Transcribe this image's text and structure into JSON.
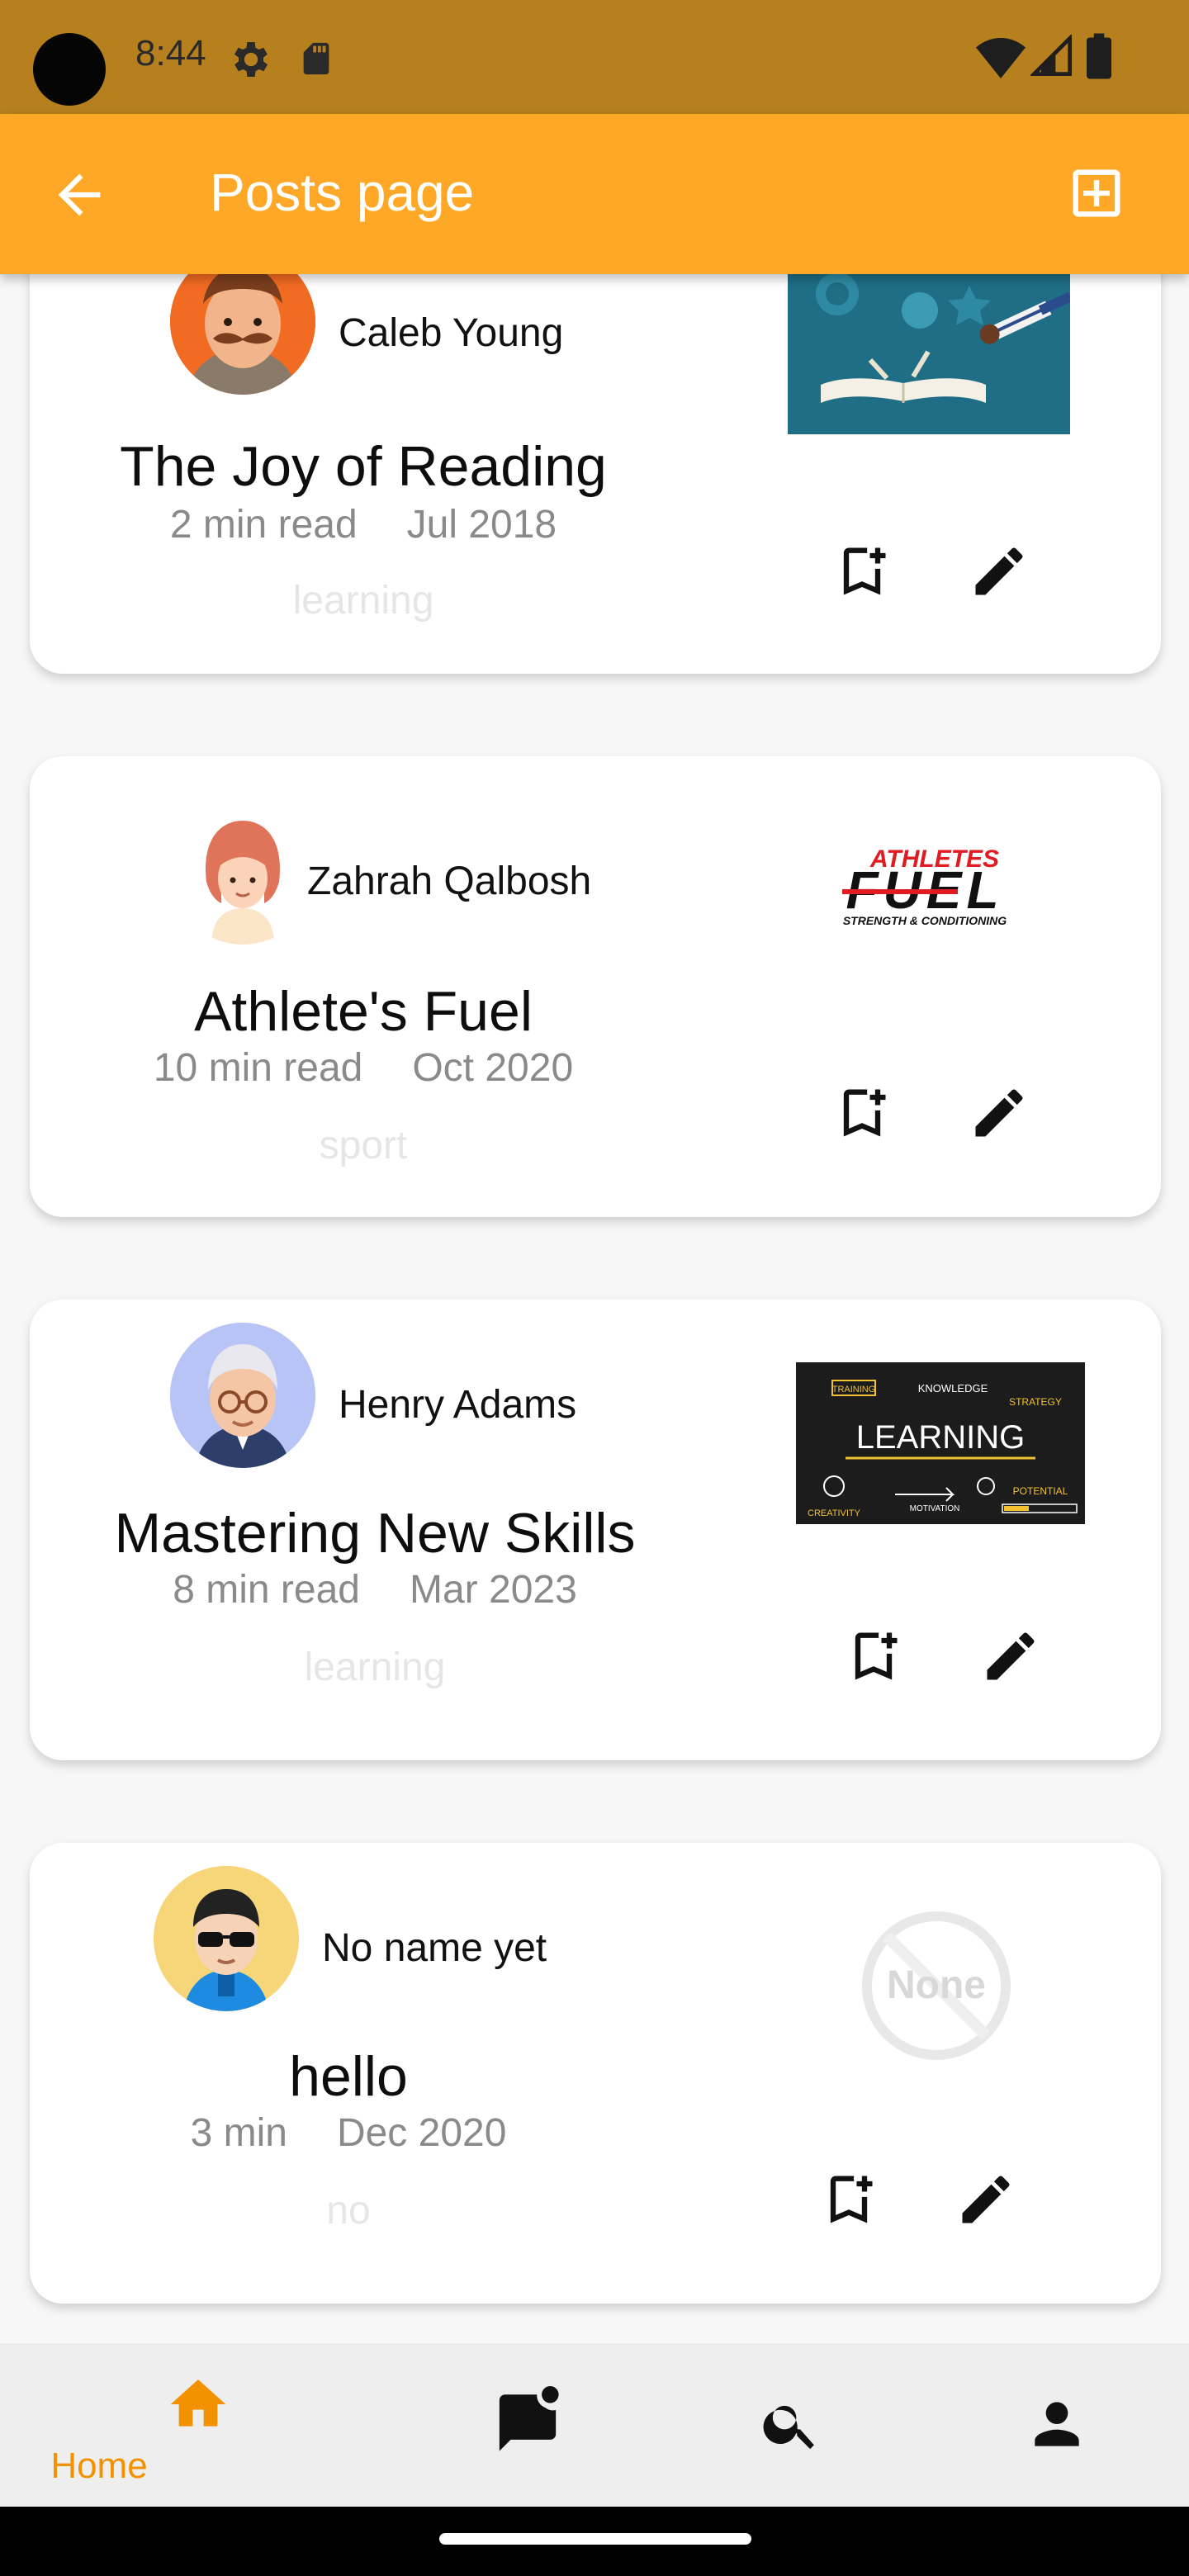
{
  "status_bar": {
    "time": "8:44",
    "background": "#B5801D"
  },
  "app_bar": {
    "title": "Posts page",
    "background": "#FFA726",
    "back_icon": "arrow-back-icon",
    "add_icon": "add-box-icon"
  },
  "posts": [
    {
      "author": "Caleb Young",
      "title": "The Joy of Reading",
      "read_time": "2 min read",
      "date": "Jul 2018",
      "tag": "learning",
      "avatar_icon": "mustache-man-avatar",
      "thumbnail_icon": "reading-illustration"
    },
    {
      "author": "Zahrah Qalbosh",
      "title": "Athlete's Fuel",
      "read_time": "10 min read",
      "date": "Oct 2020",
      "tag": "sport",
      "avatar_icon": "woman-avatar",
      "thumbnail_icon": "athletes-fuel-logo",
      "thumbnail_text": {
        "line1": "ATHLETES",
        "line2": "FUEL",
        "line3": "STRENGTH & CONDITIONING"
      }
    },
    {
      "author": "Henry Adams",
      "title": "Mastering New Skills",
      "read_time": "8 min read",
      "date": "Mar 2023",
      "tag": "learning",
      "avatar_icon": "old-man-avatar",
      "thumbnail_icon": "learning-chalkboard",
      "thumbnail_text": {
        "main": "LEARNING",
        "training": "TRAINING",
        "knowledge": "KNOWLEDGE",
        "strategy": "STRATEGY",
        "creativity": "CREATIVITY",
        "motivation": "MOTIVATION",
        "potential": "POTENTIAL"
      }
    },
    {
      "author": "No name yet",
      "title": "hello",
      "read_time": "3 min",
      "date": "Dec 2020",
      "tag": "no",
      "avatar_icon": "sunglasses-man-avatar",
      "thumbnail_icon": "none-placeholder",
      "thumbnail_text": {
        "label": "None"
      }
    }
  ],
  "post_actions": {
    "bookmark_icon": "bookmark-add-icon",
    "edit_icon": "edit-pencil-icon"
  },
  "bottom_nav": {
    "items": [
      {
        "label": "Home",
        "icon": "home-icon",
        "active": true
      },
      {
        "label": "",
        "icon": "chat-notification-icon",
        "active": false
      },
      {
        "label": "",
        "icon": "search-icon",
        "active": false
      },
      {
        "label": "",
        "icon": "person-icon",
        "active": false
      }
    ],
    "active_color": "#F39200",
    "inactive_color": "#111111"
  }
}
